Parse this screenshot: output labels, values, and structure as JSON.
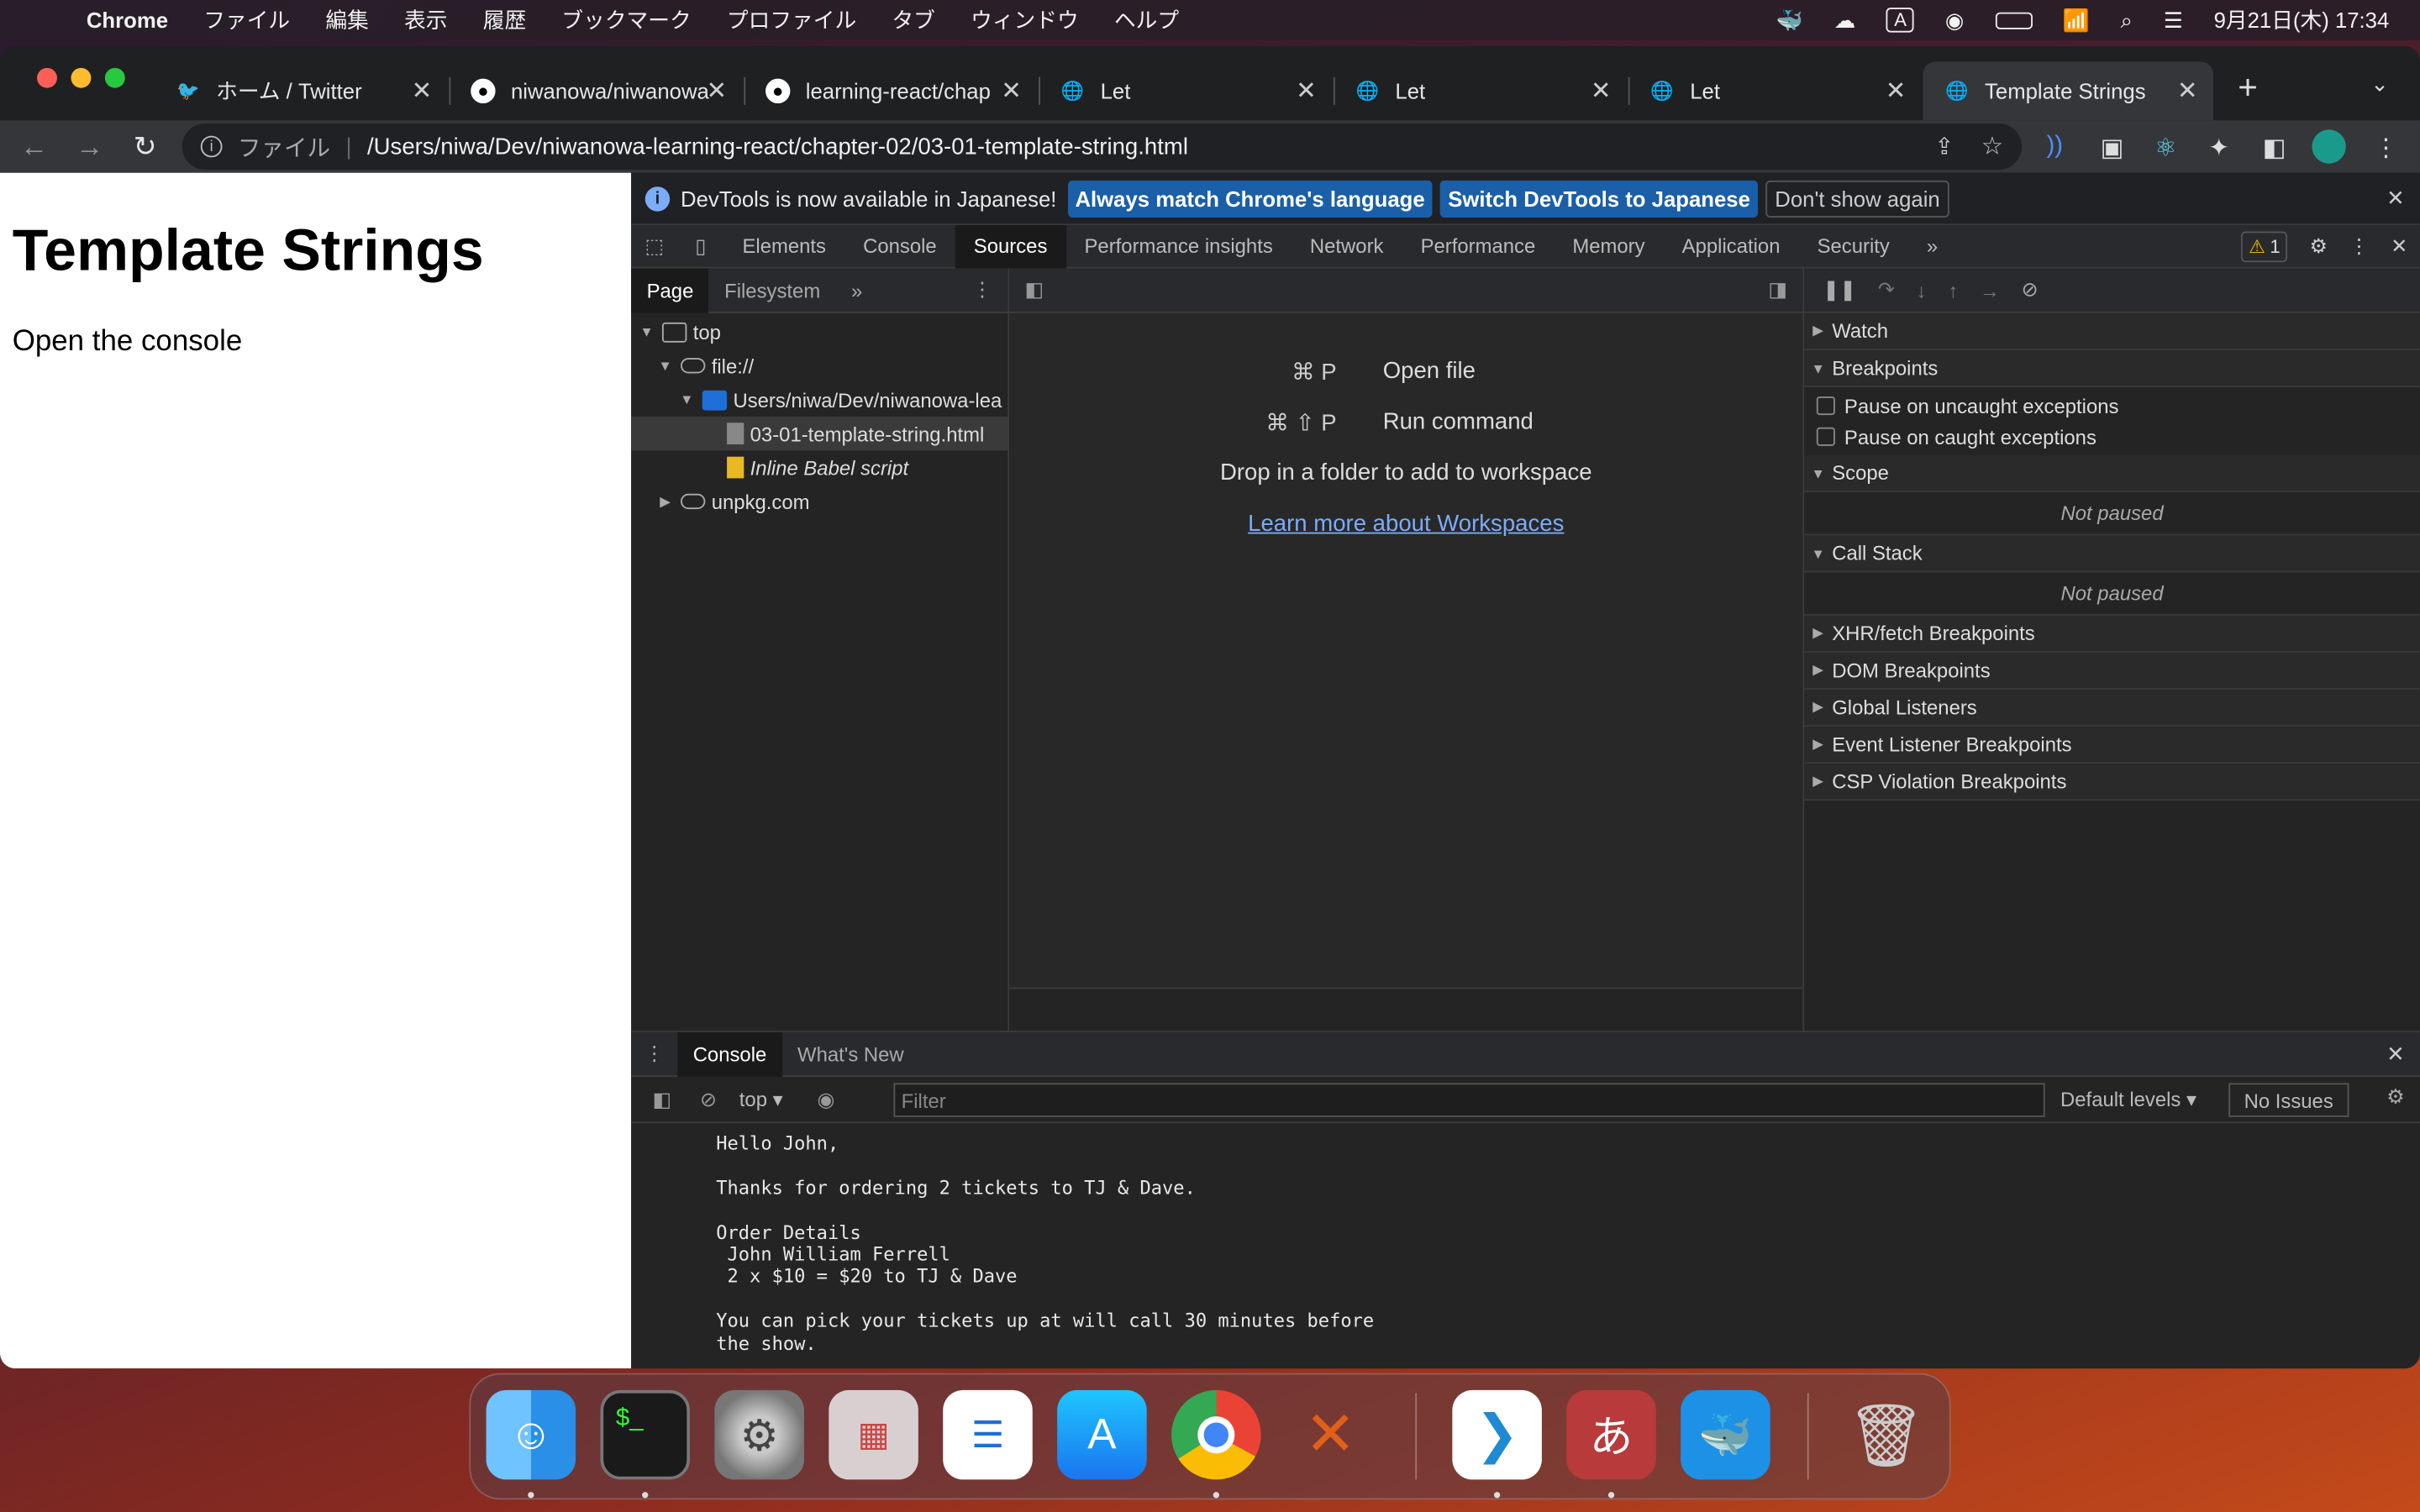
{
  "menubar": {
    "app": "Chrome",
    "items": [
      "ファイル",
      "編集",
      "表示",
      "履歴",
      "ブックマーク",
      "プロファイル",
      "タブ",
      "ウィンドウ",
      "ヘルプ"
    ],
    "input_mode": "A",
    "datetime": "9月21日(木) 17:34"
  },
  "tabs": [
    {
      "label": "ホーム / Twitter"
    },
    {
      "label": "niwanowa/niwanowa"
    },
    {
      "label": "learning-react/chap"
    },
    {
      "label": "Let"
    },
    {
      "label": "Let"
    },
    {
      "label": "Let"
    },
    {
      "label": "Template Strings"
    }
  ],
  "address": {
    "scheme": "ファイル",
    "url": "/Users/niwa/Dev/niwanowa-learning-react/chapter-02/03-01-template-string.html"
  },
  "page": {
    "heading": "Template Strings",
    "text": "Open the console"
  },
  "devtools": {
    "infobar": {
      "message": "DevTools is now available in Japanese!",
      "btn_match": "Always match Chrome's language",
      "btn_switch": "Switch DevTools to Japanese",
      "btn_dont": "Don't show again"
    },
    "tabs": [
      "Elements",
      "Console",
      "Sources",
      "Performance insights",
      "Network",
      "Performance",
      "Memory",
      "Application",
      "Security"
    ],
    "warnings": "1",
    "navigator": {
      "tabs": [
        "Page",
        "Filesystem"
      ],
      "tree": [
        {
          "label": "top"
        },
        {
          "label": "file://"
        },
        {
          "label": "Users/niwa/Dev/niwanowa-lea"
        },
        {
          "label": "03-01-template-string.html"
        },
        {
          "label": "Inline Babel script"
        },
        {
          "label": "unpkg.com"
        }
      ]
    },
    "editor": {
      "open_keys": "⌘ P",
      "open_label": "Open file",
      "run_keys": "⌘ ⇧ P",
      "run_label": "Run command",
      "drop": "Drop in a folder to add to workspace",
      "learn": "Learn more about Workspaces"
    },
    "debugger": {
      "watch": "Watch",
      "breakpoints": "Breakpoints",
      "uncaught": "Pause on uncaught exceptions",
      "caught": "Pause on caught exceptions",
      "scope": "Scope",
      "not_paused": "Not paused",
      "callstack": "Call Stack",
      "xhr": "XHR/fetch Breakpoints",
      "dom": "DOM Breakpoints",
      "global": "Global Listeners",
      "event": "Event Listener Breakpoints",
      "csp": "CSP Violation Breakpoints"
    },
    "drawer": {
      "tabs": [
        "Console",
        "What's New"
      ],
      "context": "top",
      "filter_placeholder": "Filter",
      "levels": "Default levels",
      "issues": "No Issues",
      "output": "Hello John,\n\nThanks for ordering 2 tickets to TJ & Dave.\n\nOrder Details\n John William Ferrell\n 2 x $10 = $20 to TJ & Dave\n\nYou can pick your tickets up at will call 30 minutes before\nthe show."
    }
  },
  "dock": {
    "apps": [
      "Finder",
      "Terminal",
      "System Settings",
      "Launchpad",
      "Reminders",
      "App Store",
      "Chrome",
      "XQuartz",
      "VS Code",
      "Kotoeri",
      "Docker",
      "Trash"
    ]
  }
}
